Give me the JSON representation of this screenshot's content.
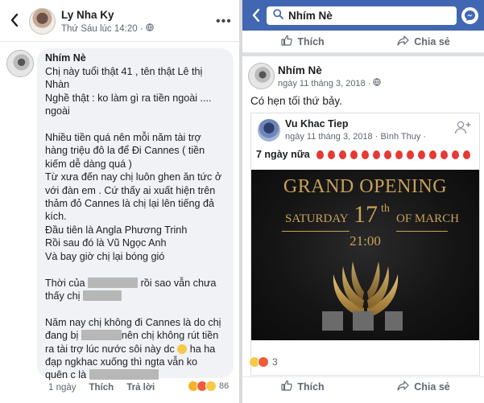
{
  "left": {
    "header": {
      "name": "Ly Nha Ky",
      "time": "Thứ Sáu lúc 14:20 ·"
    },
    "comment": {
      "author": "Nhím Nè",
      "lines": [
        "Chị này tuổi thật 41 , tên thật Lê thị",
        "Nhàn",
        "Nghề thật : ko làm gì ra tiền ngoài ....",
        "ngoài",
        "Nhiều tiền quá nên mỗi năm tài trợ",
        "hàng triệu đô la để Đi Cannes ( tiền",
        "kiếm dễ dàng quá )",
        "Từ xưa đến nay chị luôn ghen ăn tức ở",
        "với đàn em . Cứ thấy ai xuất hiện trên",
        "thảm đỏ Cannes là chị lại lên tiếng đả",
        "kích.",
        "Đầu tiên là Angla Phương Trinh",
        "Rồi sau đó là Vũ Ngọc Anh",
        "Và bay giờ chị lại bóng gió",
        "Thời của",
        "rồi sao vẫn chưa",
        "thấy chị",
        "Năm nay chị không đi Cannes là do chị",
        "đang bị",
        "nên chị không rút tiền",
        "ra tài trợ lúc nước sôi này dc",
        "ha ha",
        "đạp ngkhac xuống thì ngta vẫn ko",
        "quên c là"
      ]
    },
    "actions": {
      "time": "1 ngày",
      "like": "Thích",
      "reply": "Trả lời"
    },
    "reaction_count": "86",
    "colors": {
      "bubble": "#f0f2f5"
    }
  },
  "right": {
    "search": {
      "value": "Nhím Nè"
    },
    "actions": {
      "like": "Thích",
      "share": "Chia sẻ"
    },
    "post": {
      "author": "Nhím Nè",
      "date": "ngày 11 tháng 3, 2018 ·",
      "text": "Có hẹn tối thứ bảy."
    },
    "shared": {
      "author": "Vu Khac Tiep",
      "date": "ngày 11 tháng 3, 2018 · Bình Thuy ·",
      "text": "7 ngày nữa",
      "poster": {
        "title": "GRAND OPENING",
        "saturday": "SATURDAY",
        "day": "17",
        "day_suffix": "th",
        "month": "OF MARCH",
        "time": "21:00"
      }
    },
    "reaction_count": "3",
    "colors": {
      "topbar": "#4267b2",
      "gold": "#c9a15a"
    }
  }
}
